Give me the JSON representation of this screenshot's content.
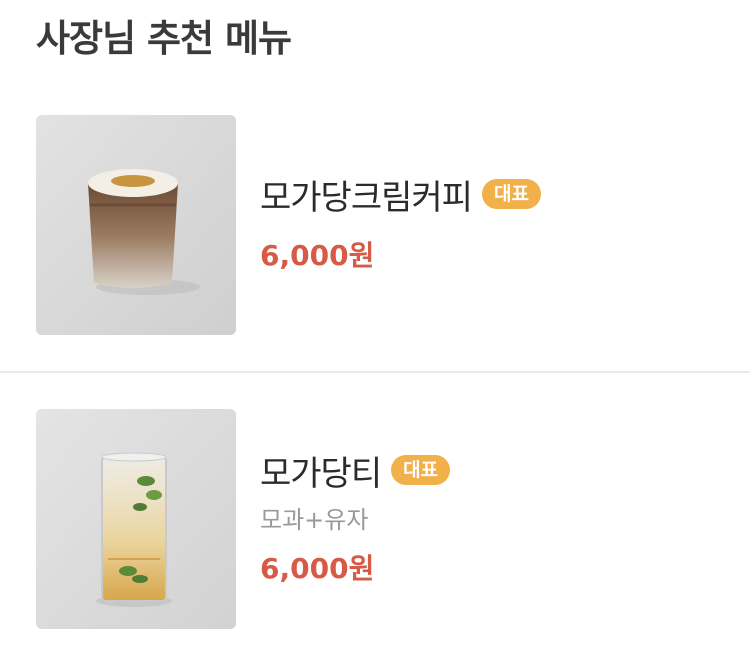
{
  "section": {
    "title": "사장님 추천 메뉴"
  },
  "menu_items": [
    {
      "name": "모가당크림커피",
      "badge": "대표",
      "description": "",
      "price": "6,000원",
      "image": "cream-coffee-photo"
    },
    {
      "name": "모가당티",
      "badge": "대표",
      "description": "모과+유자",
      "price": "6,000원",
      "image": "quince-yuja-tea-photo"
    }
  ],
  "colors": {
    "badge": "#f1b04a",
    "price": "#d65a45",
    "title": "#3a3a3a",
    "description": "#9a9a9a"
  }
}
